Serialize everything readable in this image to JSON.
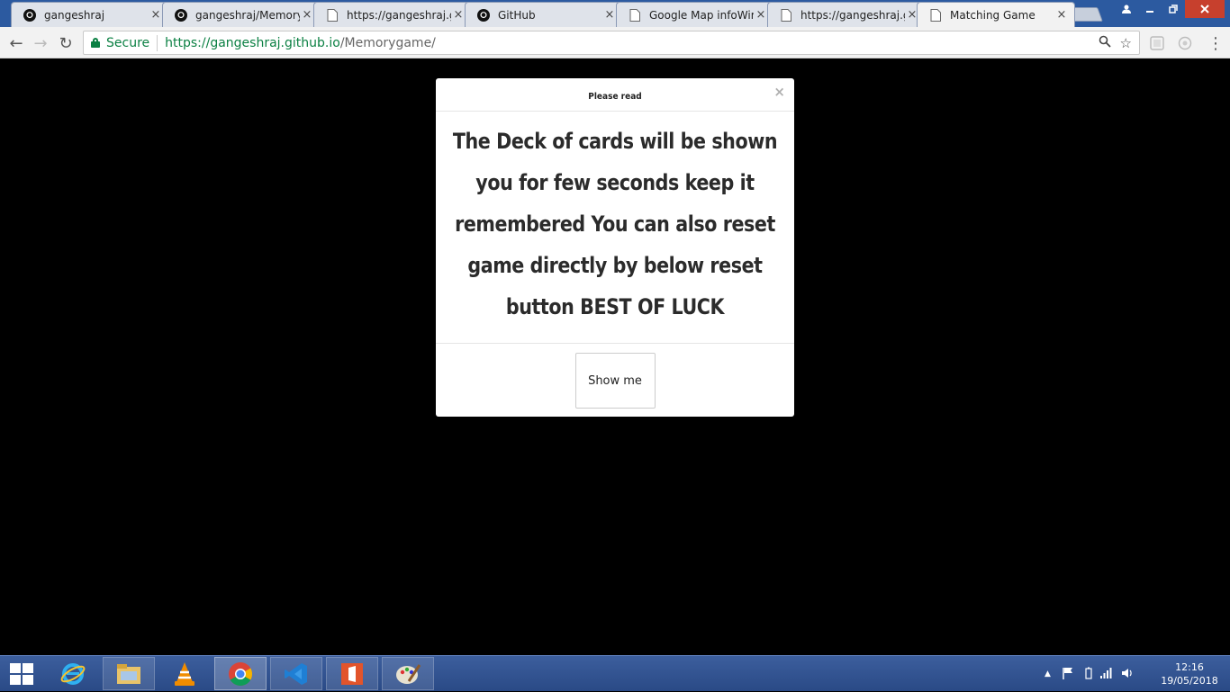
{
  "browser": {
    "tabs": [
      {
        "title": "gangeshraj",
        "icon": "github-icon"
      },
      {
        "title": "gangeshraj/Memory",
        "icon": "github-icon"
      },
      {
        "title": "https://gangeshraj.g",
        "icon": "page-icon"
      },
      {
        "title": "GitHub",
        "icon": "github-icon"
      },
      {
        "title": "Google Map infoWir",
        "icon": "page-icon"
      },
      {
        "title": "https://gangeshraj.g",
        "icon": "page-icon"
      },
      {
        "title": "Matching Game",
        "icon": "page-icon",
        "active": true
      }
    ],
    "tab_close": "×",
    "address": {
      "secure_label": "Secure",
      "url_host": "https://gangeshraj.github.io",
      "url_path": "/Memorygame/"
    },
    "nav": {
      "back": "←",
      "forward": "→",
      "reload": "↻"
    },
    "omnibox_icons": {
      "zoom": "🔍",
      "star": "☆"
    },
    "menu": "⋮"
  },
  "modal": {
    "title": "Please read",
    "close": "×",
    "body": "The Deck of cards will be shown you for few seconds keep it remembered You can also reset game directly by below reset button BEST OF LUCK",
    "button": "Show me"
  },
  "taskbar": {
    "apps": [
      "internet-explorer-icon",
      "file-explorer-icon",
      "vlc-icon",
      "chrome-icon",
      "vscode-icon",
      "office-icon",
      "paint-icon"
    ],
    "clock": {
      "time": "12:16",
      "date": "19/05/2018"
    }
  },
  "colors": {
    "tabstrip": "#2c5aa0",
    "secure_green": "#0b8043",
    "backdrop": "#000000",
    "taskbar": "#2a4a86"
  }
}
